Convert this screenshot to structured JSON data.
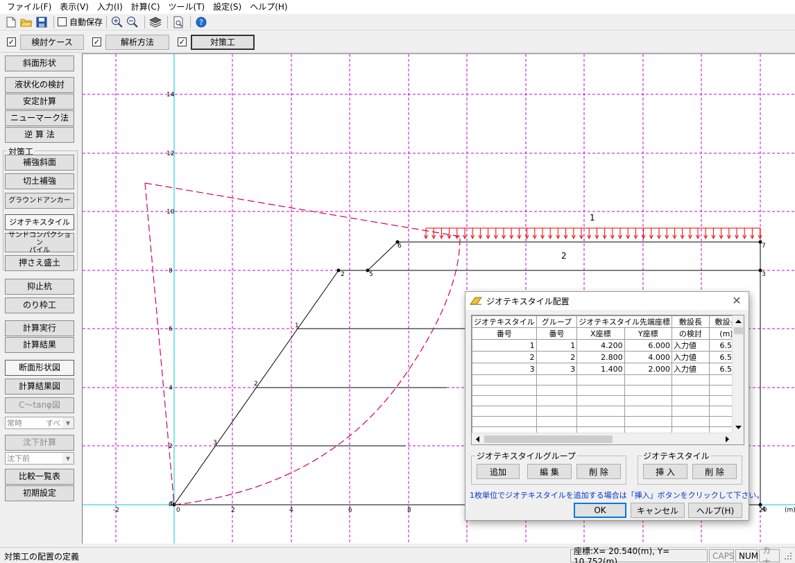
{
  "menu": [
    "ファイル(F)",
    "表示(V)",
    "入力(I)",
    "計算(C)",
    "ツール(T)",
    "設定(S)",
    "ヘルプ(H)"
  ],
  "toolbar": {
    "autosave_label": "自動保存"
  },
  "casebar": {
    "buttons": [
      "検討ケース",
      "解析方法",
      "対策工"
    ]
  },
  "left": {
    "slope_shape": "斜面形状",
    "liquefaction": "液状化の検討",
    "stability": "安定計算",
    "newmark": "ニューマーク法",
    "back_analysis": "逆 算 法",
    "countermeasure_group": "対策工",
    "reinforced_slope": "補強斜面",
    "cut_reinforce": "切土補強",
    "ground_anchor": "グラウンドアンカー",
    "geotextile": "ジオテキスタイル",
    "sand_compaction_line1": "サンドコンパクション",
    "sand_compaction_line2": "パイル",
    "counterweight": "押さえ盛土",
    "pile": "抑止杭",
    "frame": "のり枠工",
    "run_calc": "計算実行",
    "calc_result": "計算結果",
    "section_fig": "断面形状図",
    "result_fig": "計算結果図",
    "c_tan_fig": "C〜tanφ図",
    "mode_select": "常時",
    "mode_select2": "すべ",
    "settlement_calc": "沈下計算",
    "settlement_select": "沈下前",
    "comparison": "比較一覧表",
    "init_settings": "初期設定"
  },
  "plot": {
    "x_ticks": [
      "-2",
      "0",
      "2",
      "4",
      "6",
      "8",
      "20"
    ],
    "y_ticks": [
      "14",
      "12",
      "10",
      "8",
      "6",
      "4",
      "2",
      "0"
    ],
    "unit_label": "(m)",
    "node_labels": [
      "0",
      "1",
      "2",
      "5",
      "6",
      "7",
      "3",
      "4"
    ],
    "layer_labels": [
      "1",
      "2"
    ],
    "geotextile_labels": [
      "1",
      "2",
      "3"
    ]
  },
  "dialog": {
    "title": "ジオテキスタイル配置",
    "col_headers_top": [
      "ジオテキスタイル",
      "グループ",
      "ジオテキスタイル先端座標",
      "敷設長",
      "敷設長"
    ],
    "col_headers_bottom": [
      "番号",
      "番号",
      "X座標",
      "Y座標",
      "の検討",
      "(m)"
    ],
    "rows": [
      {
        "no": "1",
        "group": "1",
        "x": "4.200",
        "y": "6.000",
        "check": "入力値",
        "length": "6.500"
      },
      {
        "no": "2",
        "group": "2",
        "x": "2.800",
        "y": "4.000",
        "check": "入力値",
        "length": "6.500"
      },
      {
        "no": "3",
        "group": "3",
        "x": "1.400",
        "y": "2.000",
        "check": "入力値",
        "length": "6.500"
      }
    ],
    "group_box_label": "ジオテキスタイルグループ",
    "add": "追加",
    "edit": "編 集",
    "delete": "削 除",
    "geo_box_label": "ジオテキスタイル",
    "insert": "挿 入",
    "delete2": "削 除",
    "hint": "1枚単位でジオテキスタイルを追加する場合は「挿入」ボタンをクリックして下さい。",
    "ok": "OK",
    "cancel": "キャンセル",
    "help": "ヘルプ(H)"
  },
  "status": {
    "message": "対策工の配置の定義",
    "coords": "座標:X=  20.540(m), Y=  10.752(m)",
    "caps": "CAPS",
    "num": "NUM",
    "kana": "カナ"
  }
}
